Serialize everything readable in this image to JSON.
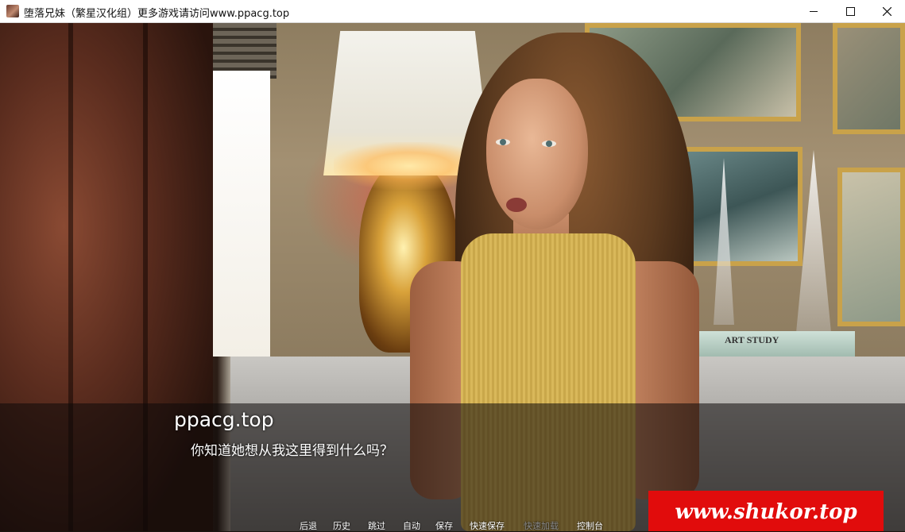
{
  "window": {
    "title": "堕落兄妹（繁星汉化组）更多游戏请访问www.ppacg.top",
    "controls": [
      "minimize-icon",
      "maximize-icon",
      "close-icon"
    ]
  },
  "scene": {
    "books_label": "ART STUDY"
  },
  "dialogue": {
    "speaker": "ppacg.top",
    "text": "你知道她想从我这里得到什么吗？"
  },
  "watermark": {
    "text": "www.shukor.top",
    "background": "#e10c0c"
  },
  "quick_menu": {
    "items": [
      {
        "label": "后退",
        "enabled": true
      },
      {
        "label": "历史",
        "enabled": true
      },
      {
        "label": "跳过",
        "enabled": true
      },
      {
        "label": "自动",
        "enabled": true
      },
      {
        "label": "保存",
        "enabled": true
      },
      {
        "label": "快速保存",
        "enabled": true
      },
      {
        "label": "快速加载",
        "enabled": false
      },
      {
        "label": "控制台",
        "enabled": true
      }
    ]
  }
}
